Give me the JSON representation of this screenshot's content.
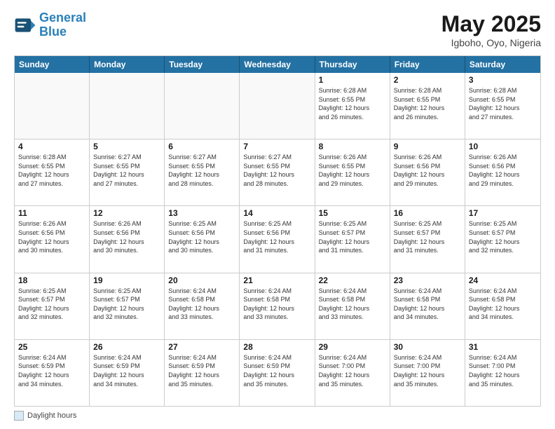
{
  "header": {
    "logo_line1": "General",
    "logo_line2": "Blue",
    "main_title": "May 2025",
    "subtitle": "Igboho, Oyo, Nigeria"
  },
  "weekdays": [
    "Sunday",
    "Monday",
    "Tuesday",
    "Wednesday",
    "Thursday",
    "Friday",
    "Saturday"
  ],
  "footer": {
    "legend_label": "Daylight hours"
  },
  "rows": [
    [
      {
        "day": "",
        "info": ""
      },
      {
        "day": "",
        "info": ""
      },
      {
        "day": "",
        "info": ""
      },
      {
        "day": "",
        "info": ""
      },
      {
        "day": "1",
        "info": "Sunrise: 6:28 AM\nSunset: 6:55 PM\nDaylight: 12 hours\nand 26 minutes."
      },
      {
        "day": "2",
        "info": "Sunrise: 6:28 AM\nSunset: 6:55 PM\nDaylight: 12 hours\nand 26 minutes."
      },
      {
        "day": "3",
        "info": "Sunrise: 6:28 AM\nSunset: 6:55 PM\nDaylight: 12 hours\nand 27 minutes."
      }
    ],
    [
      {
        "day": "4",
        "info": "Sunrise: 6:28 AM\nSunset: 6:55 PM\nDaylight: 12 hours\nand 27 minutes."
      },
      {
        "day": "5",
        "info": "Sunrise: 6:27 AM\nSunset: 6:55 PM\nDaylight: 12 hours\nand 27 minutes."
      },
      {
        "day": "6",
        "info": "Sunrise: 6:27 AM\nSunset: 6:55 PM\nDaylight: 12 hours\nand 28 minutes."
      },
      {
        "day": "7",
        "info": "Sunrise: 6:27 AM\nSunset: 6:55 PM\nDaylight: 12 hours\nand 28 minutes."
      },
      {
        "day": "8",
        "info": "Sunrise: 6:26 AM\nSunset: 6:55 PM\nDaylight: 12 hours\nand 29 minutes."
      },
      {
        "day": "9",
        "info": "Sunrise: 6:26 AM\nSunset: 6:56 PM\nDaylight: 12 hours\nand 29 minutes."
      },
      {
        "day": "10",
        "info": "Sunrise: 6:26 AM\nSunset: 6:56 PM\nDaylight: 12 hours\nand 29 minutes."
      }
    ],
    [
      {
        "day": "11",
        "info": "Sunrise: 6:26 AM\nSunset: 6:56 PM\nDaylight: 12 hours\nand 30 minutes."
      },
      {
        "day": "12",
        "info": "Sunrise: 6:26 AM\nSunset: 6:56 PM\nDaylight: 12 hours\nand 30 minutes."
      },
      {
        "day": "13",
        "info": "Sunrise: 6:25 AM\nSunset: 6:56 PM\nDaylight: 12 hours\nand 30 minutes."
      },
      {
        "day": "14",
        "info": "Sunrise: 6:25 AM\nSunset: 6:56 PM\nDaylight: 12 hours\nand 31 minutes."
      },
      {
        "day": "15",
        "info": "Sunrise: 6:25 AM\nSunset: 6:57 PM\nDaylight: 12 hours\nand 31 minutes."
      },
      {
        "day": "16",
        "info": "Sunrise: 6:25 AM\nSunset: 6:57 PM\nDaylight: 12 hours\nand 31 minutes."
      },
      {
        "day": "17",
        "info": "Sunrise: 6:25 AM\nSunset: 6:57 PM\nDaylight: 12 hours\nand 32 minutes."
      }
    ],
    [
      {
        "day": "18",
        "info": "Sunrise: 6:25 AM\nSunset: 6:57 PM\nDaylight: 12 hours\nand 32 minutes."
      },
      {
        "day": "19",
        "info": "Sunrise: 6:25 AM\nSunset: 6:57 PM\nDaylight: 12 hours\nand 32 minutes."
      },
      {
        "day": "20",
        "info": "Sunrise: 6:24 AM\nSunset: 6:58 PM\nDaylight: 12 hours\nand 33 minutes."
      },
      {
        "day": "21",
        "info": "Sunrise: 6:24 AM\nSunset: 6:58 PM\nDaylight: 12 hours\nand 33 minutes."
      },
      {
        "day": "22",
        "info": "Sunrise: 6:24 AM\nSunset: 6:58 PM\nDaylight: 12 hours\nand 33 minutes."
      },
      {
        "day": "23",
        "info": "Sunrise: 6:24 AM\nSunset: 6:58 PM\nDaylight: 12 hours\nand 34 minutes."
      },
      {
        "day": "24",
        "info": "Sunrise: 6:24 AM\nSunset: 6:58 PM\nDaylight: 12 hours\nand 34 minutes."
      }
    ],
    [
      {
        "day": "25",
        "info": "Sunrise: 6:24 AM\nSunset: 6:59 PM\nDaylight: 12 hours\nand 34 minutes."
      },
      {
        "day": "26",
        "info": "Sunrise: 6:24 AM\nSunset: 6:59 PM\nDaylight: 12 hours\nand 34 minutes."
      },
      {
        "day": "27",
        "info": "Sunrise: 6:24 AM\nSunset: 6:59 PM\nDaylight: 12 hours\nand 35 minutes."
      },
      {
        "day": "28",
        "info": "Sunrise: 6:24 AM\nSunset: 6:59 PM\nDaylight: 12 hours\nand 35 minutes."
      },
      {
        "day": "29",
        "info": "Sunrise: 6:24 AM\nSunset: 7:00 PM\nDaylight: 12 hours\nand 35 minutes."
      },
      {
        "day": "30",
        "info": "Sunrise: 6:24 AM\nSunset: 7:00 PM\nDaylight: 12 hours\nand 35 minutes."
      },
      {
        "day": "31",
        "info": "Sunrise: 6:24 AM\nSunset: 7:00 PM\nDaylight: 12 hours\nand 35 minutes."
      }
    ]
  ]
}
